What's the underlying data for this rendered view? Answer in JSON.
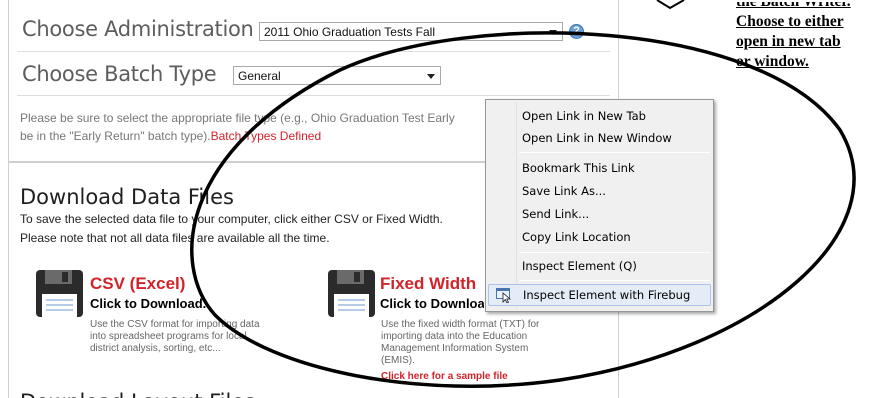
{
  "admin": {
    "label": "Choose Administration",
    "selected": "2011 Ohio Graduation Tests Fall",
    "help": "?"
  },
  "batch": {
    "label": "Choose Batch Type",
    "selected": "General"
  },
  "note": {
    "line1": "Please be sure to select the appropriate file type (e.g., Ohio Graduation Test Early",
    "line2": "be in the \"Early Return\" batch type).",
    "link": "Batch Types Defined"
  },
  "download": {
    "heading": "Download Data Files",
    "line1": "To save the selected data file to your computer, click either CSV or Fixed Width.",
    "line2": "Please note that not all data files are available all the time.",
    "csv": {
      "title": "CSV (Excel)",
      "sub": "Click to Download.",
      "desc1": "Use the CSV format for importing data",
      "desc2": "into spreadsheet programs for local",
      "desc3": "district analysis, sorting, etc..."
    },
    "fixed": {
      "title": "Fixed Width",
      "sub": "Click to Download.",
      "desc1": "Use the fixed width format (TXT) for",
      "desc2": "importing data into the Education",
      "desc3": "Management Information System",
      "desc4": "(EMIS).",
      "sample": "Click here for a sample file"
    },
    "next_heading": "Download Layout Files"
  },
  "context_menu": {
    "items": [
      {
        "label": "Open Link in New Tab"
      },
      {
        "label": "Open Link in New Window"
      },
      {
        "label": "Bookmark This Link"
      },
      {
        "label": "Save Link As..."
      },
      {
        "label": "Send Link..."
      },
      {
        "label": "Copy Link Location"
      },
      {
        "label": "Inspect Element (Q)"
      },
      {
        "label": "Inspect Element with Firebug"
      }
    ]
  },
  "annotation": {
    "line0": "the Batch Writer.",
    "line1": "Choose to either",
    "line2": "open in new tab",
    "line3": "or window."
  }
}
